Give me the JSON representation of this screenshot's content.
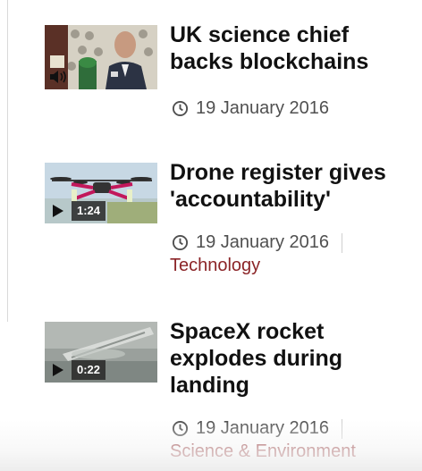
{
  "stories": [
    {
      "title": "UK science chief backs blockchains",
      "date": "19 January 2016",
      "media": "audio",
      "section": "",
      "duration": ""
    },
    {
      "title": "Drone register gives 'accountability'",
      "date": "19 January 2016",
      "media": "video",
      "section": "Technology",
      "duration": "1:24"
    },
    {
      "title": "SpaceX rocket explodes during landing",
      "date": "19 January 2016",
      "media": "video",
      "section": "Science & Environment",
      "duration": "0:22"
    }
  ],
  "icons": {
    "clock": "clock-icon",
    "play": "play-icon",
    "speaker": "speaker-icon"
  },
  "colors": {
    "section_link": "#8b2427",
    "title": "#111111",
    "meta": "#505050"
  }
}
